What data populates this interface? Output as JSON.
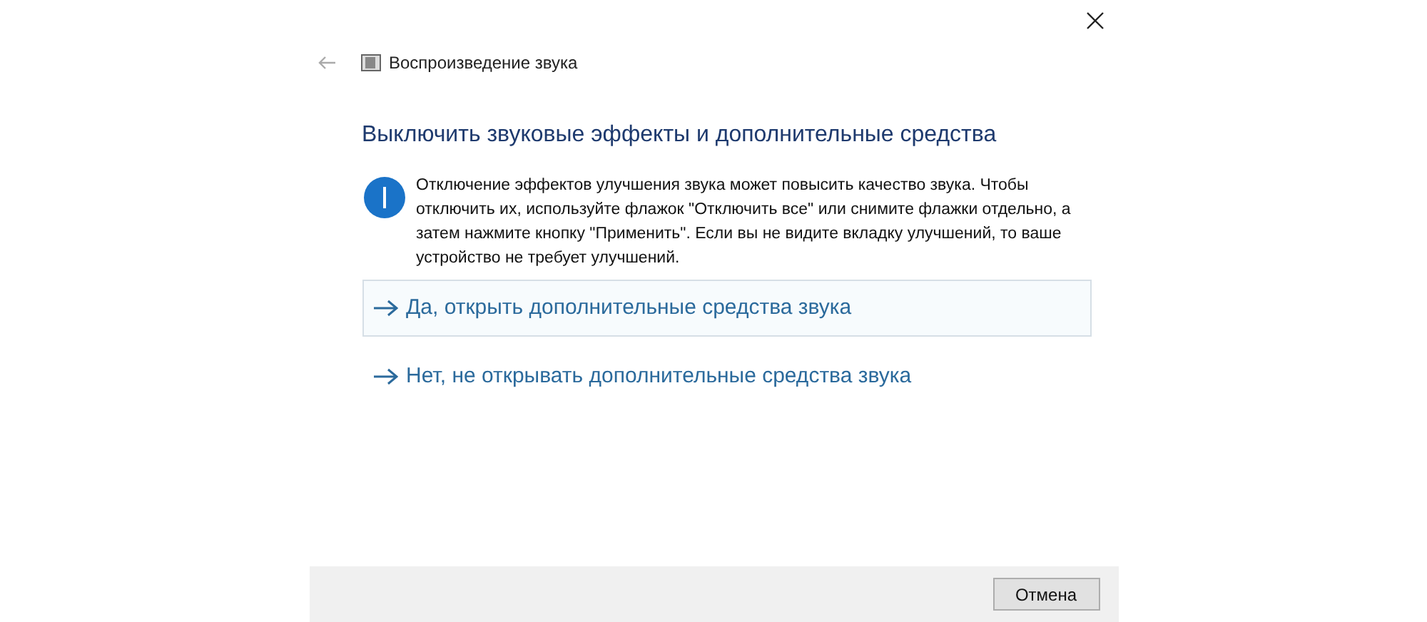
{
  "window": {
    "title": "Воспроизведение звука"
  },
  "heading": "Выключить звуковые эффекты и дополнительные средства",
  "info": "Отключение эффектов улучшения звука может повысить качество звука. Чтобы отключить их, используйте флажок \"Отключить все\" или снимите флажки отдельно, а затем нажмите кнопку \"Применить\". Если вы не видите вкладку улучшений, то ваше устройство не требует улучшений.",
  "options": [
    {
      "label": "Да, открыть дополнительные средства звука",
      "selected": true
    },
    {
      "label": "Нет, не открывать дополнительные средства звука",
      "selected": false
    }
  ],
  "buttons": [
    "Отмена"
  ]
}
